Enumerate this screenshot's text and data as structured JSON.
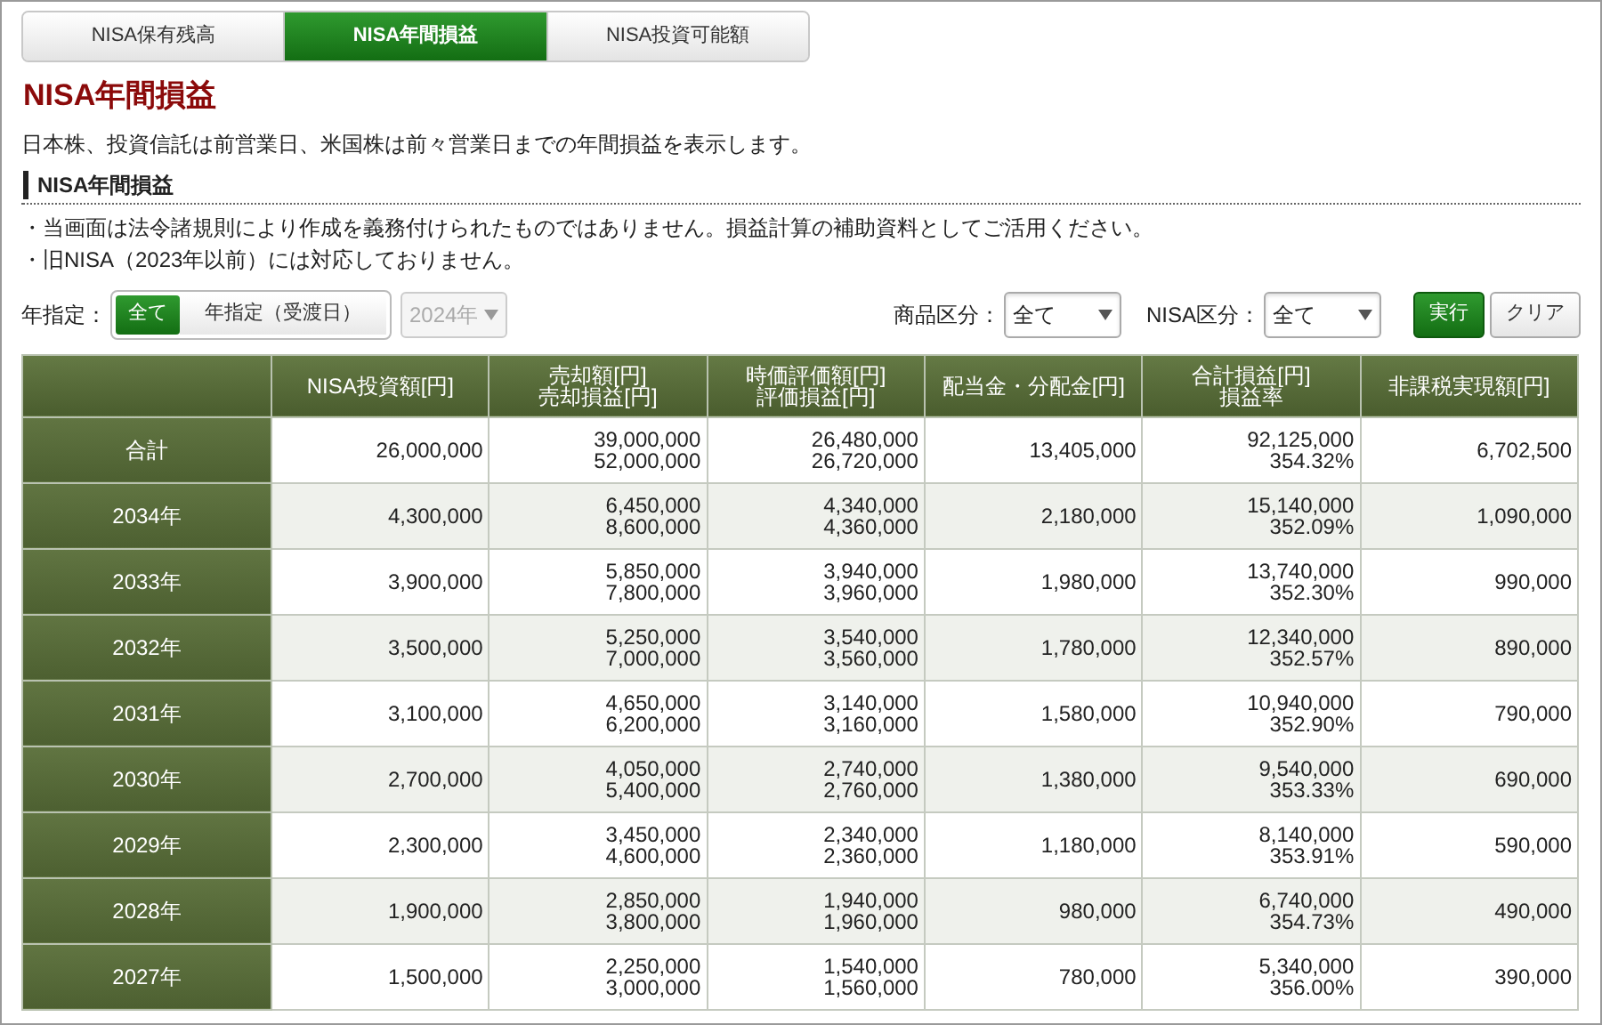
{
  "tabs": [
    {
      "label": "NISA保有残高",
      "selected": false
    },
    {
      "label": "NISA年間損益",
      "selected": true
    },
    {
      "label": "NISA投資可能額",
      "selected": false
    }
  ],
  "page_title": "NISA年間損益",
  "description": "日本株、投資信託は前営業日、米国株は前々営業日までの年間損益を表示します。",
  "section_heading": "NISA年間損益",
  "notes": [
    "・当画面は法令諸規則により作成を義務付けられたものではありません。損益計算の補助資料としてご活用ください。",
    "・旧NISA（2023年以前）には対応しておりません。"
  ],
  "filters": {
    "year_label": "年指定：",
    "year_options": [
      {
        "label": "全て",
        "selected": true
      },
      {
        "label": "年指定（受渡日）",
        "selected": false
      }
    ],
    "year_select": {
      "value": "2024年",
      "disabled": true
    },
    "product_label": "商品区分：",
    "product_select": {
      "value": "全て",
      "disabled": false
    },
    "nisa_label": "NISA区分：",
    "nisa_select": {
      "value": "全て",
      "disabled": false
    },
    "buttons": [
      {
        "label": "実行",
        "kind": "primary"
      },
      {
        "label": "クリア",
        "kind": "secondary"
      }
    ]
  },
  "table": {
    "columns": [
      "",
      "NISA投資額[円]",
      "売却額[円]\n売却損益[円]",
      "時価評価額[円]\n評価損益[円]",
      "配当金・分配金[円]",
      "合計損益[円]\n損益率",
      "非課税実現額[円]"
    ],
    "rows": [
      [
        "合計",
        "26,000,000",
        "39,000,000\n52,000,000",
        "26,480,000\n26,720,000",
        "13,405,000",
        "92,125,000\n354.32%",
        "6,702,500"
      ],
      [
        "2034年",
        "4,300,000",
        "6,450,000\n8,600,000",
        "4,340,000\n4,360,000",
        "2,180,000",
        "15,140,000\n352.09%",
        "1,090,000"
      ],
      [
        "2033年",
        "3,900,000",
        "5,850,000\n7,800,000",
        "3,940,000\n3,960,000",
        "1,980,000",
        "13,740,000\n352.30%",
        "990,000"
      ],
      [
        "2032年",
        "3,500,000",
        "5,250,000\n7,000,000",
        "3,540,000\n3,560,000",
        "1,780,000",
        "12,340,000\n352.57%",
        "890,000"
      ],
      [
        "2031年",
        "3,100,000",
        "4,650,000\n6,200,000",
        "3,140,000\n3,160,000",
        "1,580,000",
        "10,940,000\n352.90%",
        "790,000"
      ],
      [
        "2030年",
        "2,700,000",
        "4,050,000\n5,400,000",
        "2,740,000\n2,760,000",
        "1,380,000",
        "9,540,000\n353.33%",
        "690,000"
      ],
      [
        "2029年",
        "2,300,000",
        "3,450,000\n4,600,000",
        "2,340,000\n2,360,000",
        "1,180,000",
        "8,140,000\n353.91%",
        "590,000"
      ],
      [
        "2028年",
        "1,900,000",
        "2,850,000\n3,800,000",
        "1,940,000\n1,960,000",
        "980,000",
        "6,740,000\n354.73%",
        "490,000"
      ],
      [
        "2027年",
        "1,500,000",
        "2,250,000\n3,000,000",
        "1,540,000\n1,560,000",
        "780,000",
        "5,340,000\n356.00%",
        "390,000"
      ]
    ]
  }
}
